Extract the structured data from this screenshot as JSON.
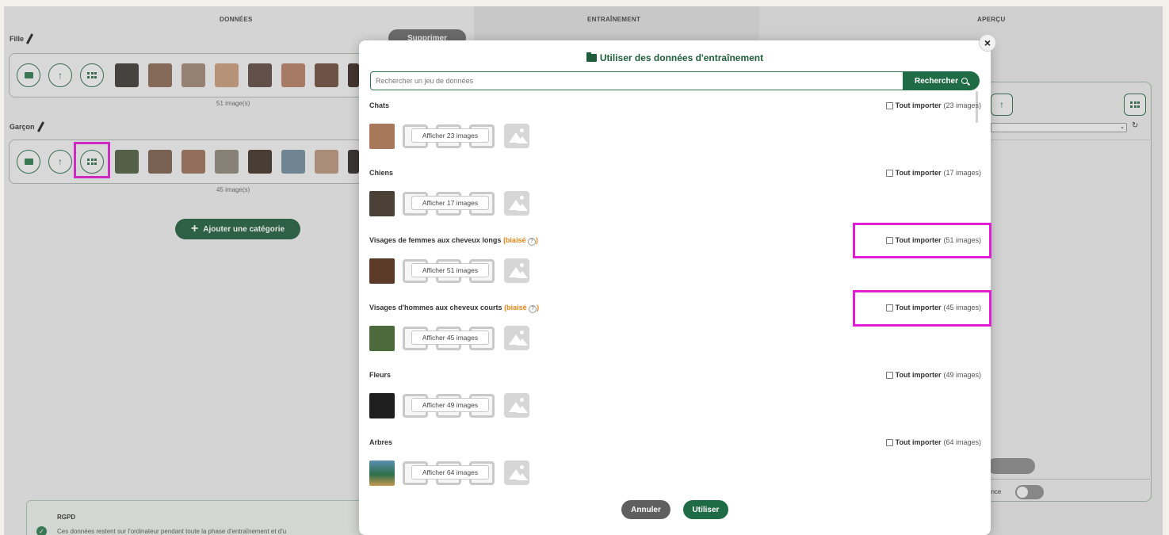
{
  "columns": {
    "donnees": "DONNÉES",
    "entrainement": "ENTRAÎNEMENT",
    "apercu": "APERÇU"
  },
  "categories": [
    {
      "name": "Fille",
      "count_label": "51 image(s)"
    },
    {
      "name": "Garçon",
      "count_label": "45 image(s)"
    }
  ],
  "background": {
    "delete_label": "Supprimer",
    "add_category_label": "Ajouter une catégorie",
    "rgpd_title": "RGPD",
    "rgpd_text": "Ces données restent sur l'ordinateur pendant toute la phase d'entraînement et d'u",
    "confidence_label": "ence"
  },
  "modal": {
    "title": "Utiliser des données d'entraînement",
    "search_placeholder": "Rechercher un jeu de données",
    "search_button": "Rechercher",
    "datasets": [
      {
        "name": "Chats",
        "biased": "",
        "import_label": "Tout importer",
        "import_count": "(23 images)",
        "show_label": "Afficher 23 images"
      },
      {
        "name": "Chiens",
        "biased": "",
        "import_label": "Tout importer",
        "import_count": "(17 images)",
        "show_label": "Afficher 17 images"
      },
      {
        "name": "Visages de femmes aux cheveux longs",
        "biased": "(biaisé",
        "import_label": "Tout importer",
        "import_count": "(51 images)",
        "show_label": "Afficher 51 images"
      },
      {
        "name": "Visages d'hommes aux cheveux courts",
        "biased": "(biaisé",
        "import_label": "Tout importer",
        "import_count": "(45 images)",
        "show_label": "Afficher 45 images"
      },
      {
        "name": "Fleurs",
        "biased": "",
        "import_label": "Tout importer",
        "import_count": "(49 images)",
        "show_label": "Afficher 49 images"
      },
      {
        "name": "Arbres",
        "biased": "",
        "import_label": "Tout importer",
        "import_count": "(64 images)",
        "show_label": "Afficher 64 images"
      }
    ],
    "cancel_label": "Annuler",
    "use_label": "Utiliser",
    "close_symbol": "×"
  },
  "colors": {
    "primary": "#1f6b45",
    "biased": "#e8841a",
    "highlight": "#e11ed3"
  },
  "icons": [
    "pencil-icon",
    "record-icon",
    "upload-icon",
    "grid-icon",
    "folder-icon",
    "search-icon",
    "image-placeholder-icon",
    "help-icon",
    "close-icon",
    "refresh-icon",
    "check-icon"
  ]
}
